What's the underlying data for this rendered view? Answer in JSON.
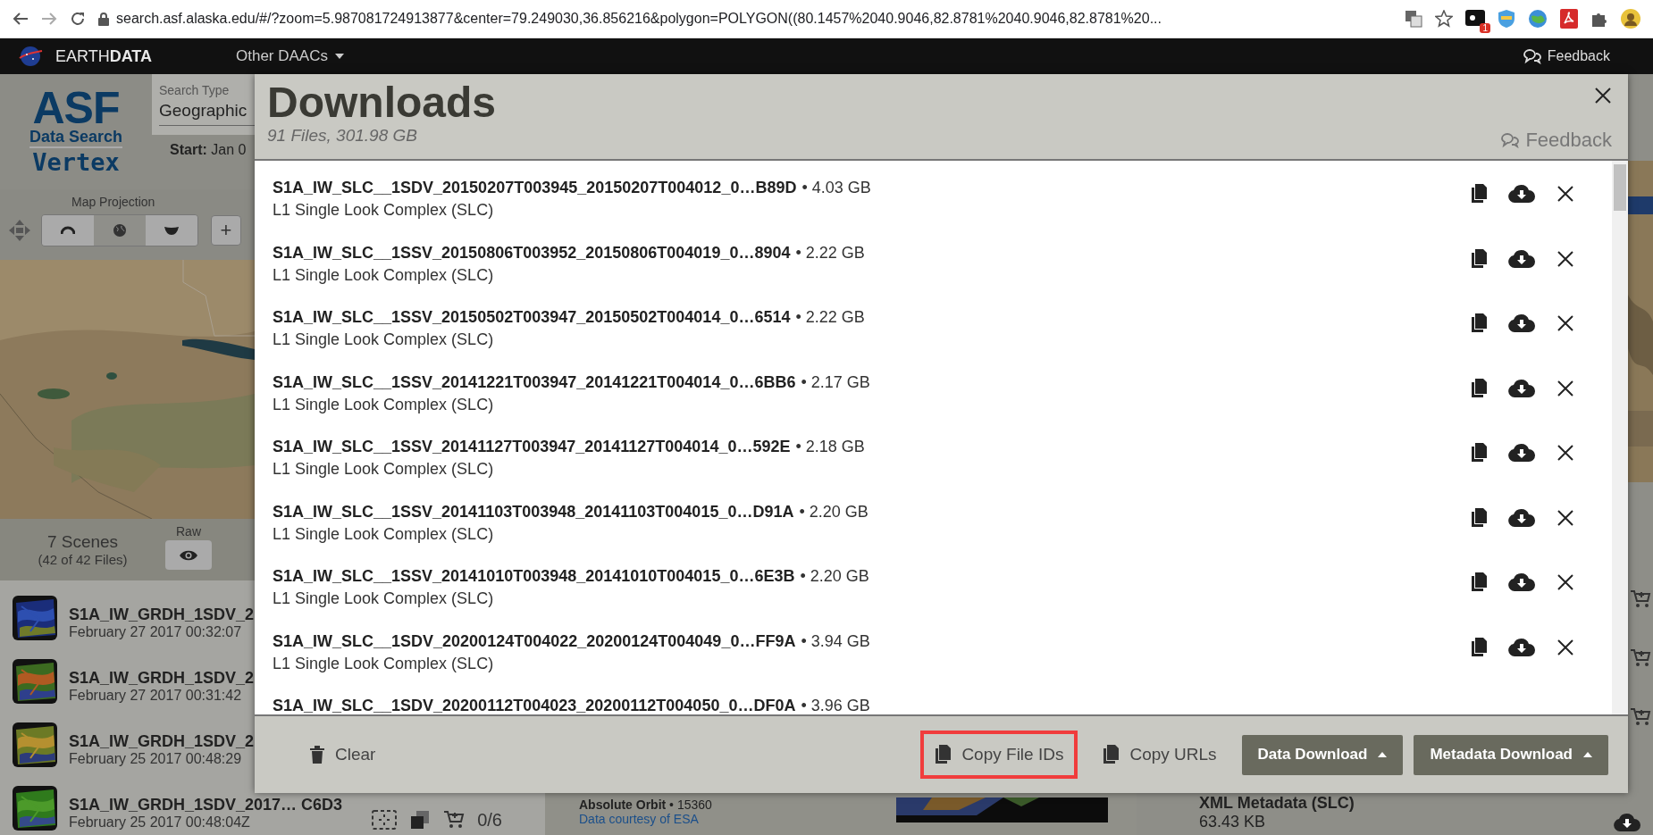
{
  "browser": {
    "url": "search.asf.alaska.edu/#/?zoom=5.987081724913877&center=79.249030,36.856216&polygon=POLYGON((80.1457%2040.9046,82.8781%2040.9046,82.8781%20...",
    "extension_badge": "1"
  },
  "topbar": {
    "brand": "EARTH**DATA**",
    "menu": "Other DAACs",
    "feedback": "Feedback"
  },
  "app": {
    "logo": {
      "title": "ASF",
      "subtitle": "Data Search",
      "name": "Vertex"
    },
    "search_type": {
      "label": "Search Type",
      "value": "Geographic"
    },
    "start": "**Start:** Jan 0",
    "map_projection": {
      "label": "Map Projection",
      "options": [
        {
          "kind": "arctic",
          "selected": false
        },
        {
          "kind": "equatorial",
          "selected": true
        },
        {
          "kind": "antarctic",
          "selected": false
        }
      ]
    },
    "zoom_in": "+",
    "scenes": {
      "count": "7 Scenes",
      "files": "(42 of 42 Files)",
      "raw_label": "Raw"
    },
    "scene_list": [
      {
        "name": "S1A_IW_GRDH_1SDV_2",
        "date": "February 27 2017 00:32:07"
      },
      {
        "name": "S1A_IW_GRDH_1SDV_2",
        "date": "February 27 2017 00:31:42"
      },
      {
        "name": "S1A_IW_GRDH_1SDV_2",
        "date": "February 25 2017 00:48:29"
      },
      {
        "name": "S1A_IW_GRDH_1SDV_2017… C6D3",
        "date": "February 25 2017 00:48:04Z",
        "cart": "0/6"
      }
    ]
  },
  "details": {
    "orbit": "**Absolute Orbit** • 15360",
    "credit": "Data courtesy of ESA"
  },
  "files_panel": {
    "title": "XML Metadata (SLC)",
    "size": "63.43 KB"
  },
  "modal": {
    "title": "Downloads",
    "summary": "91 Files, 301.98 GB",
    "feedback": "Feedback",
    "files": [
      {
        "name": "S1A_IW_SLC__1SDV_20150207T003945_20150207T004012_0…B89D",
        "size": "• 4.03 GB",
        "type": "L1 Single Look Complex (SLC)"
      },
      {
        "name": "S1A_IW_SLC__1SSV_20150806T003952_20150806T004019_0…8904",
        "size": "• 2.22 GB",
        "type": "L1 Single Look Complex (SLC)"
      },
      {
        "name": "S1A_IW_SLC__1SSV_20150502T003947_20150502T004014_0…6514",
        "size": "• 2.22 GB",
        "type": "L1 Single Look Complex (SLC)"
      },
      {
        "name": "S1A_IW_SLC__1SSV_20141221T003947_20141221T004014_0…6BB6",
        "size": "• 2.17 GB",
        "type": "L1 Single Look Complex (SLC)"
      },
      {
        "name": "S1A_IW_SLC__1SSV_20141127T003947_20141127T004014_0…592E",
        "size": "• 2.18 GB",
        "type": "L1 Single Look Complex (SLC)"
      },
      {
        "name": "S1A_IW_SLC__1SSV_20141103T003948_20141103T004015_0…D91A",
        "size": "• 2.20 GB",
        "type": "L1 Single Look Complex (SLC)"
      },
      {
        "name": "S1A_IW_SLC__1SSV_20141010T003948_20141010T004015_0…6E3B",
        "size": "• 2.20 GB",
        "type": "L1 Single Look Complex (SLC)"
      },
      {
        "name": "S1A_IW_SLC__1SDV_20200124T004022_20200124T004049_0…FF9A",
        "size": "• 3.94 GB",
        "type": "L1 Single Look Complex (SLC)"
      },
      {
        "name": "S1A_IW_SLC__1SDV_20200112T004023_20200112T004050_0…DF0A",
        "size": "• 3.96 GB"
      }
    ],
    "buttons": [
      {
        "kind": "clear",
        "label": "Clear",
        "highlighted": false
      },
      {
        "kind": "copy",
        "label": "Copy File IDs",
        "highlighted": true
      },
      {
        "kind": "copy",
        "label": "Copy URLs",
        "highlighted": false
      },
      {
        "kind": "menu",
        "label": "Data Download"
      },
      {
        "kind": "menu",
        "label": "Metadata Download"
      }
    ]
  }
}
